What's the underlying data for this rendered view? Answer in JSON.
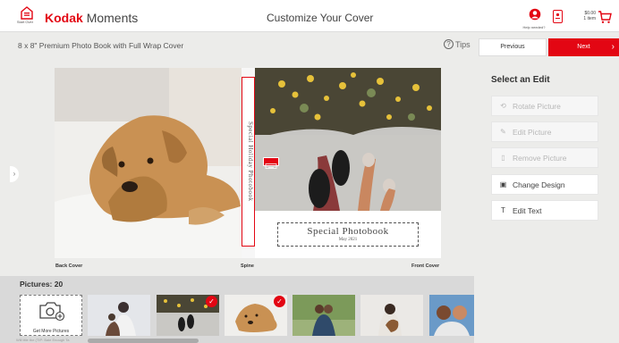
{
  "header": {
    "home_label": "Start Over",
    "brand_kodak": "Kodak",
    "brand_moments": "Moments",
    "page_title": "Customize Your Cover",
    "help_label": "Help needed?",
    "cart_amount": "$0.00",
    "cart_items": "1 item"
  },
  "subheader": {
    "product_title": "8 x 8\" Premium Photo Book with Full Wrap Cover",
    "tips_label": "Tips",
    "previous_label": "Previous",
    "next_label": "Next"
  },
  "book": {
    "spine_text": "Special Holiday Photobook",
    "cover_title": "Special Photobook",
    "cover_subtitle": "May 2021",
    "back_cover_label": "Back Cover",
    "spine_label": "Spine",
    "front_cover_label": "Front Cover"
  },
  "edit_panel": {
    "title": "Select an Edit",
    "buttons": [
      {
        "label": "Rotate Picture",
        "icon": "rotate-icon",
        "enabled": false
      },
      {
        "label": "Edit Picture",
        "icon": "pencil-icon",
        "enabled": false
      },
      {
        "label": "Remove Picture",
        "icon": "trash-icon",
        "enabled": false
      },
      {
        "label": "Change Design",
        "icon": "layout-icon",
        "enabled": true
      },
      {
        "label": "Edit Text",
        "icon": "text-icon",
        "enabled": true
      }
    ]
  },
  "pictures": {
    "label": "Pictures: 20",
    "get_more_label": "Get More Pictures",
    "footer_note": "Will title the (TIP: Bale Enough Ta"
  },
  "colors": {
    "brand_red": "#e30613",
    "background": "#ececea",
    "strip": "#d9d9d9"
  }
}
